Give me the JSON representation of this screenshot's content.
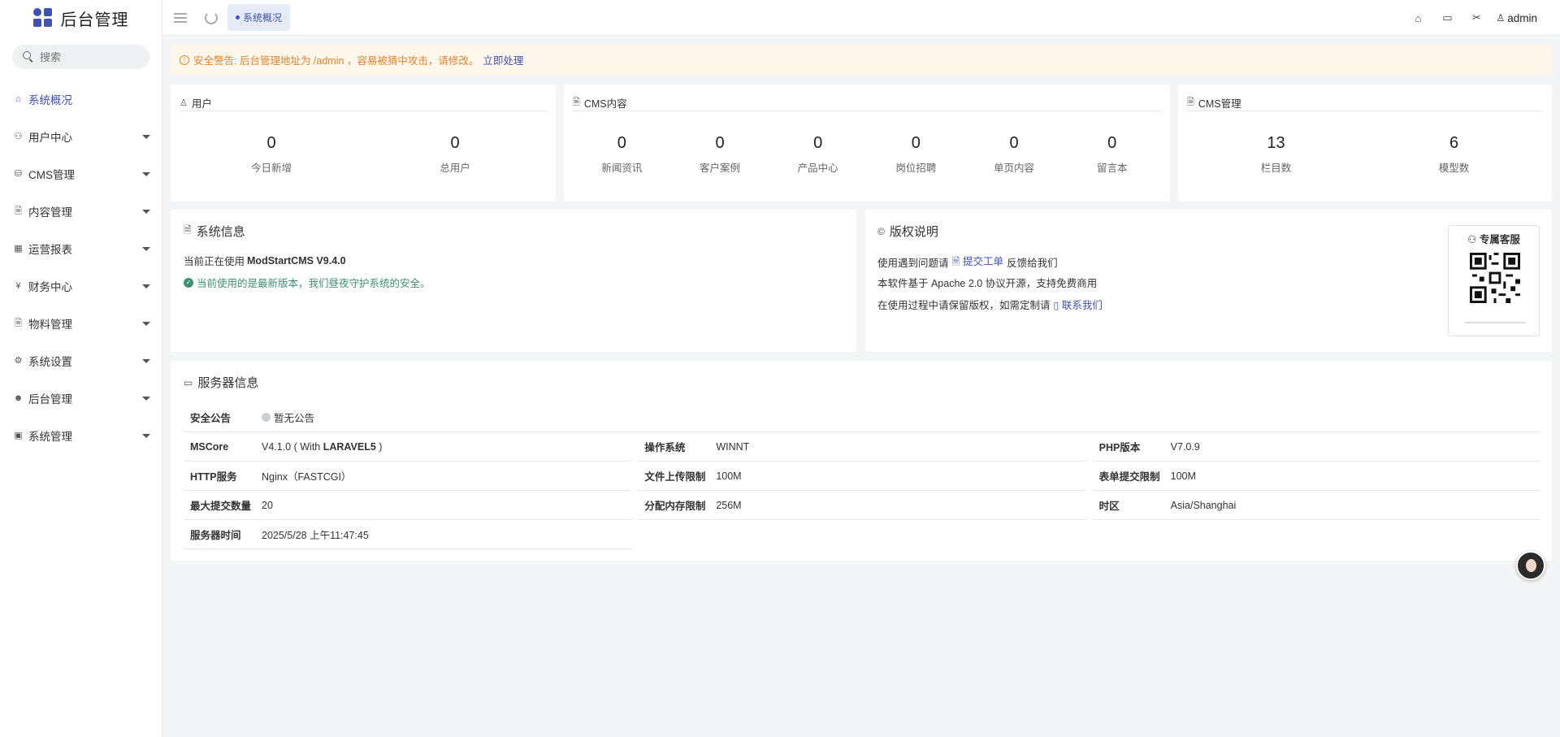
{
  "app": {
    "title": "后台管理"
  },
  "search": {
    "placeholder": "搜索"
  },
  "sidebar": {
    "items": [
      {
        "label": "系统概况",
        "icon": "home-icon",
        "active": true
      },
      {
        "label": "用户中心",
        "icon": "users-icon"
      },
      {
        "label": "CMS管理",
        "icon": "database-icon"
      },
      {
        "label": "内容管理",
        "icon": "file-icon"
      },
      {
        "label": "运营报表",
        "icon": "chart-icon"
      },
      {
        "label": "财务中心",
        "icon": "yen-icon"
      },
      {
        "label": "物料管理",
        "icon": "file-icon"
      },
      {
        "label": "系统设置",
        "icon": "gear-icon"
      },
      {
        "label": "后台管理",
        "icon": "user-circle-icon"
      },
      {
        "label": "系统管理",
        "icon": "image-icon"
      }
    ]
  },
  "topbar": {
    "tab_label": "系统概况",
    "user": "admin"
  },
  "alert": {
    "text": "安全警告: 后台管理地址为 /admin ，容易被猜中攻击，请修改。",
    "action": "立即处理"
  },
  "cards": {
    "users": {
      "title": "用户",
      "stats": [
        {
          "value": "0",
          "label": "今日新增"
        },
        {
          "value": "0",
          "label": "总用户"
        }
      ]
    },
    "cms_content": {
      "title": "CMS内容",
      "stats": [
        {
          "value": "0",
          "label": "新闻资讯"
        },
        {
          "value": "0",
          "label": "客户案例"
        },
        {
          "value": "0",
          "label": "产品中心"
        },
        {
          "value": "0",
          "label": "岗位招聘"
        },
        {
          "value": "0",
          "label": "单页内容"
        },
        {
          "value": "0",
          "label": "留言本"
        }
      ]
    },
    "cms_manage": {
      "title": "CMS管理",
      "stats": [
        {
          "value": "13",
          "label": "栏目数"
        },
        {
          "value": "6",
          "label": "模型数"
        }
      ]
    }
  },
  "system_info": {
    "title": "系统信息",
    "using_prefix": "当前正在使用",
    "version": "ModStartCMS V9.4.0",
    "latest": "当前使用的是最新版本，我们昼夜守护系统的安全。"
  },
  "copyright": {
    "title": "版权说明",
    "line1_prefix": "使用遇到问题请",
    "line1_link": "提交工单",
    "line1_suffix": "反馈给我们",
    "line2": "本软件基于 Apache 2.0 协议开源，支持免费商用",
    "line3_prefix": "在使用过程中请保留版权，如需定制请",
    "line3_link": "联系我们",
    "service_title": "专属客服"
  },
  "server": {
    "title": "服务器信息",
    "notice_label": "安全公告",
    "notice_value": "暂无公告",
    "rows": [
      [
        {
          "k": "MSCore",
          "v": "V4.1.0 ( With ",
          "v_bold": "LARAVEL5",
          "v_end": " )"
        },
        {
          "k": "操作系统",
          "v": "WINNT"
        },
        {
          "k": "PHP版本",
          "v": "V7.0.9"
        }
      ],
      [
        {
          "k": "HTTP服务",
          "v": "Nginx（FASTCGI）"
        },
        {
          "k": "文件上传限制",
          "v": "100M"
        },
        {
          "k": "表单提交限制",
          "v": "100M"
        }
      ],
      [
        {
          "k": "最大提交数量",
          "v": "20"
        },
        {
          "k": "分配内存限制",
          "v": "256M"
        },
        {
          "k": "时区",
          "v": "Asia/Shanghai"
        }
      ],
      [
        {
          "k": "服务器时间",
          "v": "2025/5/28 上午11:47:45"
        }
      ]
    ]
  },
  "colors": {
    "accent": "#3f51b5",
    "warning": "#e5842c",
    "success": "#3d8f74"
  }
}
